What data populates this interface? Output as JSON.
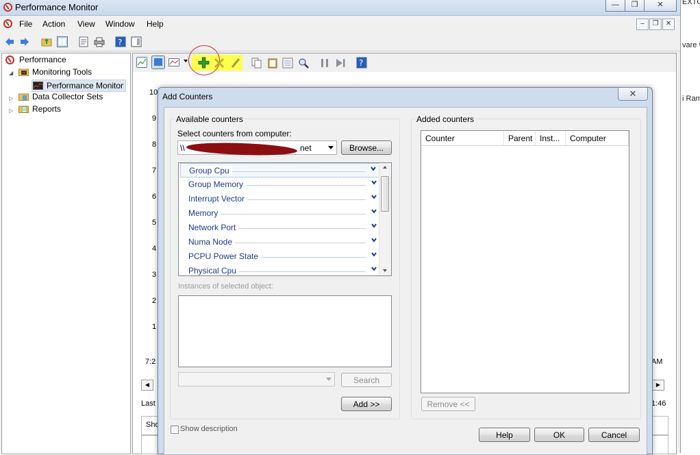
{
  "window": {
    "title": "Performance Monitor"
  },
  "menu": [
    "File",
    "Action",
    "View",
    "Window",
    "Help"
  ],
  "background_right": {
    "texts": [
      "EXTC",
      "vare v",
      "i Ram"
    ]
  },
  "tree": {
    "items": [
      {
        "label": "Performance"
      },
      {
        "label": "Monitoring Tools"
      },
      {
        "label": "Performance Monitor"
      },
      {
        "label": "Data Collector Sets"
      },
      {
        "label": "Reports"
      }
    ]
  },
  "graph": {
    "y_labels": [
      "10",
      "9",
      "8",
      "7",
      "6",
      "5",
      "4",
      "3",
      "2",
      "1"
    ],
    "time_start": "7:2",
    "time_end": "AM",
    "last_label": "Last",
    "last_value": "1:46",
    "show_label": "Sho"
  },
  "dialog": {
    "title": "Add Counters",
    "close": "✕",
    "available": {
      "group_label": "Available counters",
      "select_label": "Select counters from computer:",
      "computer_prefix": "\\\\",
      "computer_suffix": "net",
      "browse_button": "Browse...",
      "counters": [
        "Group Cpu",
        "Group Memory",
        "Interrupt Vector",
        "Memory",
        "Network Port",
        "Numa Node",
        "PCPU Power State",
        "Physical Cpu"
      ],
      "instances_label": "Instances of selected object:",
      "search_button": "Search",
      "add_button": "Add >>"
    },
    "added": {
      "group_label": "Added counters",
      "columns": [
        "Counter",
        "Parent",
        "Inst...",
        "Computer"
      ],
      "remove_button": "Remove <<"
    },
    "show_description": "Show description",
    "help_button": "Help",
    "ok_button": "OK",
    "cancel_button": "Cancel"
  },
  "colors": {
    "highlight": "#ffff4d",
    "counter_text": "#1c3a86",
    "add_icon": "#2e9e2e",
    "delete_icon": "#b8b040"
  }
}
